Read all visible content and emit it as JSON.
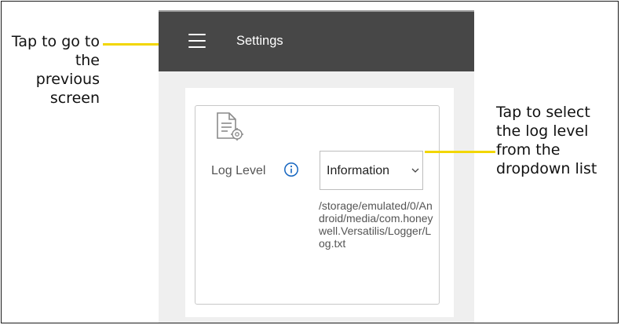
{
  "callouts": {
    "left": "Tap to go to the previous screen",
    "right": "Tap to select the log level from the dropdown list"
  },
  "colors": {
    "appbar": "#474747",
    "leader": "#f2d600",
    "info_icon": "#1565c0"
  },
  "appbar": {
    "title": "Settings",
    "menu_icon": "hamburger-menu-icon"
  },
  "settings": {
    "section_icon": "document-gear-icon",
    "log_level_label": "Log Level",
    "info_icon": "info-icon",
    "log_level_value": "Information",
    "dropdown_icon": "chevron-down-icon",
    "log_path": "/storage/emulated/0/Android/media/com.honeywell.Versatilis/Logger/Log.txt"
  }
}
